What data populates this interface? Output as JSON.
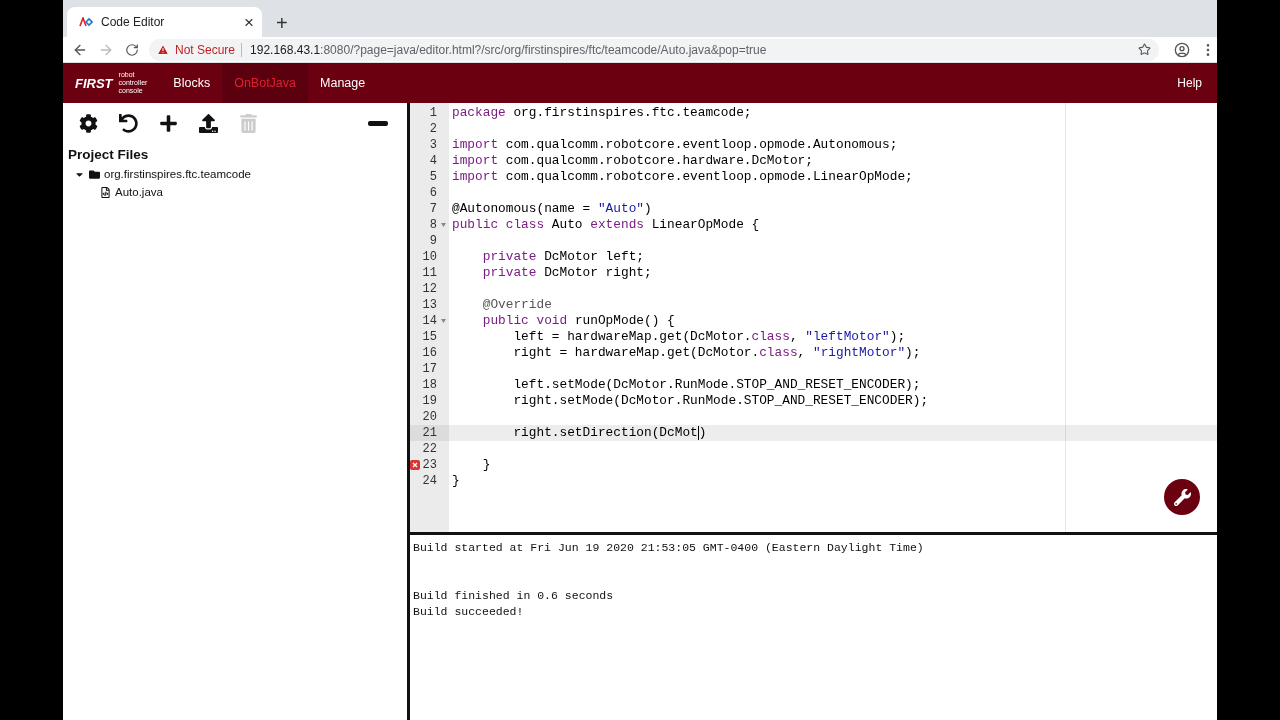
{
  "browser": {
    "tab": {
      "title": "Code Editor",
      "close": "×"
    },
    "new_tab": "+",
    "forward_disabled": true,
    "address": {
      "warning": "Not Secure",
      "host": "192.168.43.1",
      "path": ":8080/?page=java/editor.html?/src/org/firstinspires/ftc/teamcode/Auto.java&pop=true"
    }
  },
  "navbar": {
    "logo": "FIRST",
    "logo_caption": [
      "robot",
      "controller",
      "console"
    ],
    "items": [
      {
        "label": "Blocks",
        "selected": false
      },
      {
        "label": "OnBotJava",
        "selected": true
      },
      {
        "label": "Manage",
        "selected": false
      }
    ],
    "help": "Help"
  },
  "sidebar": {
    "toolbar": [
      {
        "kind": "settings",
        "disabled": false
      },
      {
        "kind": "undo",
        "disabled": false
      },
      {
        "kind": "add",
        "disabled": false
      },
      {
        "kind": "upload",
        "disabled": false
      },
      {
        "kind": "delete",
        "disabled": true
      }
    ],
    "title": "Project Files",
    "tree": [
      {
        "kind": "folder",
        "label": "org.firstinspires.ftc.teamcode",
        "expanded": true,
        "children": [
          {
            "kind": "file",
            "label": "Auto.java"
          }
        ]
      }
    ]
  },
  "editor": {
    "lines": [
      {
        "number": "1",
        "foldable": false,
        "error": false,
        "active": false,
        "tokens": [
          {
            "kind": "keyword",
            "text": "package"
          },
          {
            "kind": "plain",
            "text": " org.firstinspires.ftc.teamcode;"
          }
        ]
      },
      {
        "number": "2",
        "foldable": false,
        "error": false,
        "active": false
      },
      {
        "number": "3",
        "foldable": false,
        "error": false,
        "active": false,
        "tokens": [
          {
            "kind": "keyword",
            "text": "import"
          },
          {
            "kind": "plain",
            "text": " com.qualcomm.robotcore.eventloop.opmode.Autonomous;"
          }
        ]
      },
      {
        "number": "4",
        "foldable": false,
        "error": false,
        "active": false,
        "tokens": [
          {
            "kind": "keyword",
            "text": "import"
          },
          {
            "kind": "plain",
            "text": " com.qualcomm.robotcore.hardware.DcMotor;"
          }
        ]
      },
      {
        "number": "5",
        "foldable": false,
        "error": false,
        "active": false,
        "tokens": [
          {
            "kind": "keyword",
            "text": "import"
          },
          {
            "kind": "plain",
            "text": " com.qualcomm.robotcore.eventloop.opmode.LinearOpMode;"
          }
        ]
      },
      {
        "number": "6",
        "foldable": false,
        "error": false,
        "active": false
      },
      {
        "number": "7",
        "foldable": false,
        "error": false,
        "active": false,
        "tokens": [
          {
            "kind": "plain",
            "text": "@Autonomous(name = "
          },
          {
            "kind": "string",
            "text": "\"Auto\""
          },
          {
            "kind": "plain",
            "text": ")"
          }
        ]
      },
      {
        "number": "8",
        "foldable": true,
        "error": false,
        "active": false,
        "tokens": [
          {
            "kind": "keyword",
            "text": "public class"
          },
          {
            "kind": "plain",
            "text": " Auto "
          },
          {
            "kind": "keyword",
            "text": "extends"
          },
          {
            "kind": "plain",
            "text": " LinearOpMode {"
          }
        ]
      },
      {
        "number": "9",
        "foldable": false,
        "error": false,
        "active": false
      },
      {
        "number": "10",
        "foldable": false,
        "error": false,
        "active": false,
        "tokens": [
          {
            "kind": "keyword",
            "text": "    private"
          },
          {
            "kind": "plain",
            "text": " DcMotor left;"
          }
        ]
      },
      {
        "number": "11",
        "foldable": false,
        "error": false,
        "active": false,
        "tokens": [
          {
            "kind": "keyword",
            "text": "    private"
          },
          {
            "kind": "plain",
            "text": " DcMotor right;"
          }
        ]
      },
      {
        "number": "12",
        "foldable": false,
        "error": false,
        "active": false
      },
      {
        "number": "13",
        "foldable": false,
        "error": false,
        "active": false,
        "tokens": [
          {
            "kind": "annotation",
            "text": "    @Override"
          }
        ]
      },
      {
        "number": "14",
        "foldable": true,
        "error": false,
        "active": false,
        "tokens": [
          {
            "kind": "keyword",
            "text": "    public void"
          },
          {
            "kind": "plain",
            "text": " runOpMode() {"
          }
        ]
      },
      {
        "number": "15",
        "foldable": false,
        "error": false,
        "active": false,
        "tokens": [
          {
            "kind": "plain",
            "text": "        left = hardwareMap.get(DcMotor."
          },
          {
            "kind": "keyword",
            "text": "class"
          },
          {
            "kind": "plain",
            "text": ", "
          },
          {
            "kind": "string",
            "text": "\"leftMotor\""
          },
          {
            "kind": "plain",
            "text": ");"
          }
        ]
      },
      {
        "number": "16",
        "foldable": false,
        "error": false,
        "active": false,
        "tokens": [
          {
            "kind": "plain",
            "text": "        right = hardwareMap.get(DcMotor."
          },
          {
            "kind": "keyword",
            "text": "class"
          },
          {
            "kind": "plain",
            "text": ", "
          },
          {
            "kind": "string",
            "text": "\"rightMotor\""
          },
          {
            "kind": "plain",
            "text": ");"
          }
        ]
      },
      {
        "number": "17",
        "foldable": false,
        "error": false,
        "active": false
      },
      {
        "number": "18",
        "foldable": false,
        "error": false,
        "active": false,
        "tokens": [
          {
            "kind": "plain",
            "text": "        left.setMode(DcMotor.RunMode.STOP_AND_RESET_ENCODER);"
          }
        ]
      },
      {
        "number": "19",
        "foldable": false,
        "error": false,
        "active": false,
        "tokens": [
          {
            "kind": "plain",
            "text": "        right.setMode(DcMotor.RunMode.STOP_AND_RESET_ENCODER);"
          }
        ]
      },
      {
        "number": "20",
        "foldable": false,
        "error": false,
        "active": false
      },
      {
        "number": "21",
        "foldable": false,
        "error": false,
        "active": true,
        "tokens": [
          {
            "kind": "plain",
            "text": "        right.setDirection(DcMot"
          },
          {
            "kind": "cursor"
          },
          {
            "kind": "plain",
            "text": ")"
          }
        ]
      },
      {
        "number": "22",
        "foldable": false,
        "error": false,
        "active": false
      },
      {
        "number": "23",
        "foldable": false,
        "error": true,
        "active": false,
        "tokens": [
          {
            "kind": "plain",
            "text": "    }"
          }
        ]
      },
      {
        "number": "24",
        "foldable": false,
        "error": false,
        "active": false,
        "tokens": [
          {
            "kind": "plain",
            "text": "}"
          }
        ]
      }
    ]
  },
  "console": {
    "blocks": [
      {
        "lines": [
          "Build started at Fri Jun 19 2020 21:53:05 GMT-0400 (Eastern Daylight Time)"
        ]
      },
      {
        "lines": [
          "Build finished in 0.6 seconds",
          "Build succeeded!"
        ]
      }
    ]
  }
}
